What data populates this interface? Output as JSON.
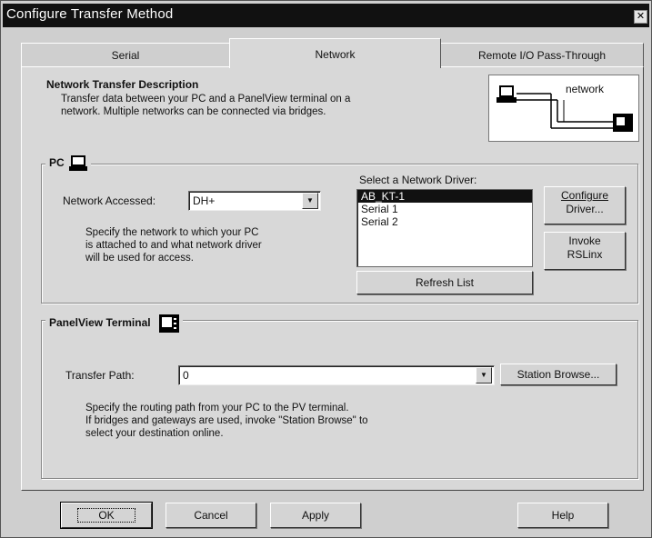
{
  "window": {
    "title": "Configure Transfer Method",
    "close_glyph": "✕"
  },
  "tabs": [
    {
      "label": "Serial"
    },
    {
      "label": "Network",
      "active": true
    },
    {
      "label": "Remote I/O Pass-Through"
    }
  ],
  "description": {
    "heading": "Network Transfer Description",
    "line1": "Transfer data between your PC and a PanelView terminal on a",
    "line2": "network.  Multiple networks can be connected via bridges.",
    "diagram_label": "network"
  },
  "pc": {
    "legend": "PC",
    "network_label": "Network Accessed:",
    "network_value": "DH+",
    "help_line1": "Specify the network to which your PC",
    "help_line2": "is attached to and what network driver",
    "help_line3": "will be used for access.",
    "driver_label": "Select a Network Driver:",
    "drivers": [
      "AB_KT-1",
      "Serial 1",
      "Serial 2"
    ],
    "selected_driver": "AB_KT-1",
    "refresh_label": "Refresh List",
    "configure_line1": "Configure",
    "configure_line2": "Driver...",
    "invoke_line1": "Invoke",
    "invoke_line2": "RSLinx"
  },
  "terminal": {
    "legend": "PanelView Terminal",
    "path_label": "Transfer Path:",
    "path_value": "0",
    "browse_label": "Station Browse...",
    "help_line1": "Specify the routing path from your PC to the PV terminal.",
    "help_line2": "If bridges and gateways are used, invoke \"Station Browse\" to",
    "help_line3": "select your destination online."
  },
  "footer": {
    "ok": "OK",
    "cancel": "Cancel",
    "apply": "Apply",
    "help": "Help"
  }
}
